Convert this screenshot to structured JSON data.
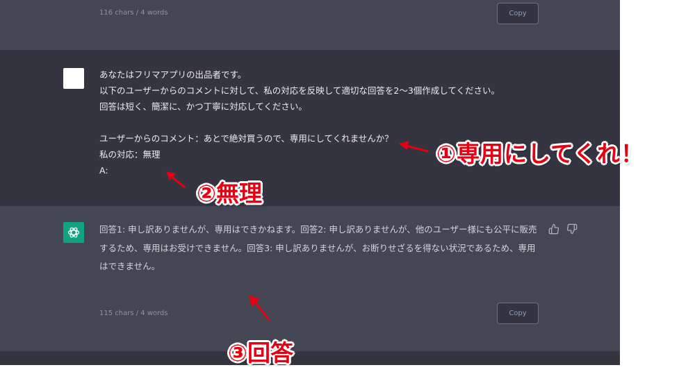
{
  "top_message": {
    "stats": "116 chars / 4 words",
    "copy_label": "Copy"
  },
  "user_message": {
    "avatar": "user-avatar-blank",
    "text": "あなたはフリマアプリの出品者です。\n以下のユーザーからのコメントに対して、私の対応を反映して適切な回答を2〜3個作成してください。\n回答は短く、簡潔に、かつ丁寧に対応してください。\n\nユーザーからのコメント：あとで絶対買うので、専用にしてくれませんか？\n私の対応：無理\nA:"
  },
  "assistant_message": {
    "avatar": "openai-logo-icon",
    "text": "回答1: 申し訳ありませんが、専用はできかねます。回答2: 申し訳ありませんが、他のユーザー様にも公平に販売するため、専用はお受けできません。回答3: 申し訳ありませんが、お断りせざるを得ない状況であるため、専用はできません。",
    "stats": "115 chars / 4 words",
    "copy_label": "Copy",
    "thumbs_up_icon": "thumbs-up-icon",
    "thumbs_down_icon": "thumbs-down-icon"
  },
  "annotations": [
    {
      "label": "①専用にしてくれ！"
    },
    {
      "label": "②無理"
    },
    {
      "label": "③回答"
    }
  ],
  "colors": {
    "panel_light": "#444654",
    "panel_dark": "#343541",
    "assistant_avatar": "#10a37f",
    "annotation_red": "#e60012"
  }
}
